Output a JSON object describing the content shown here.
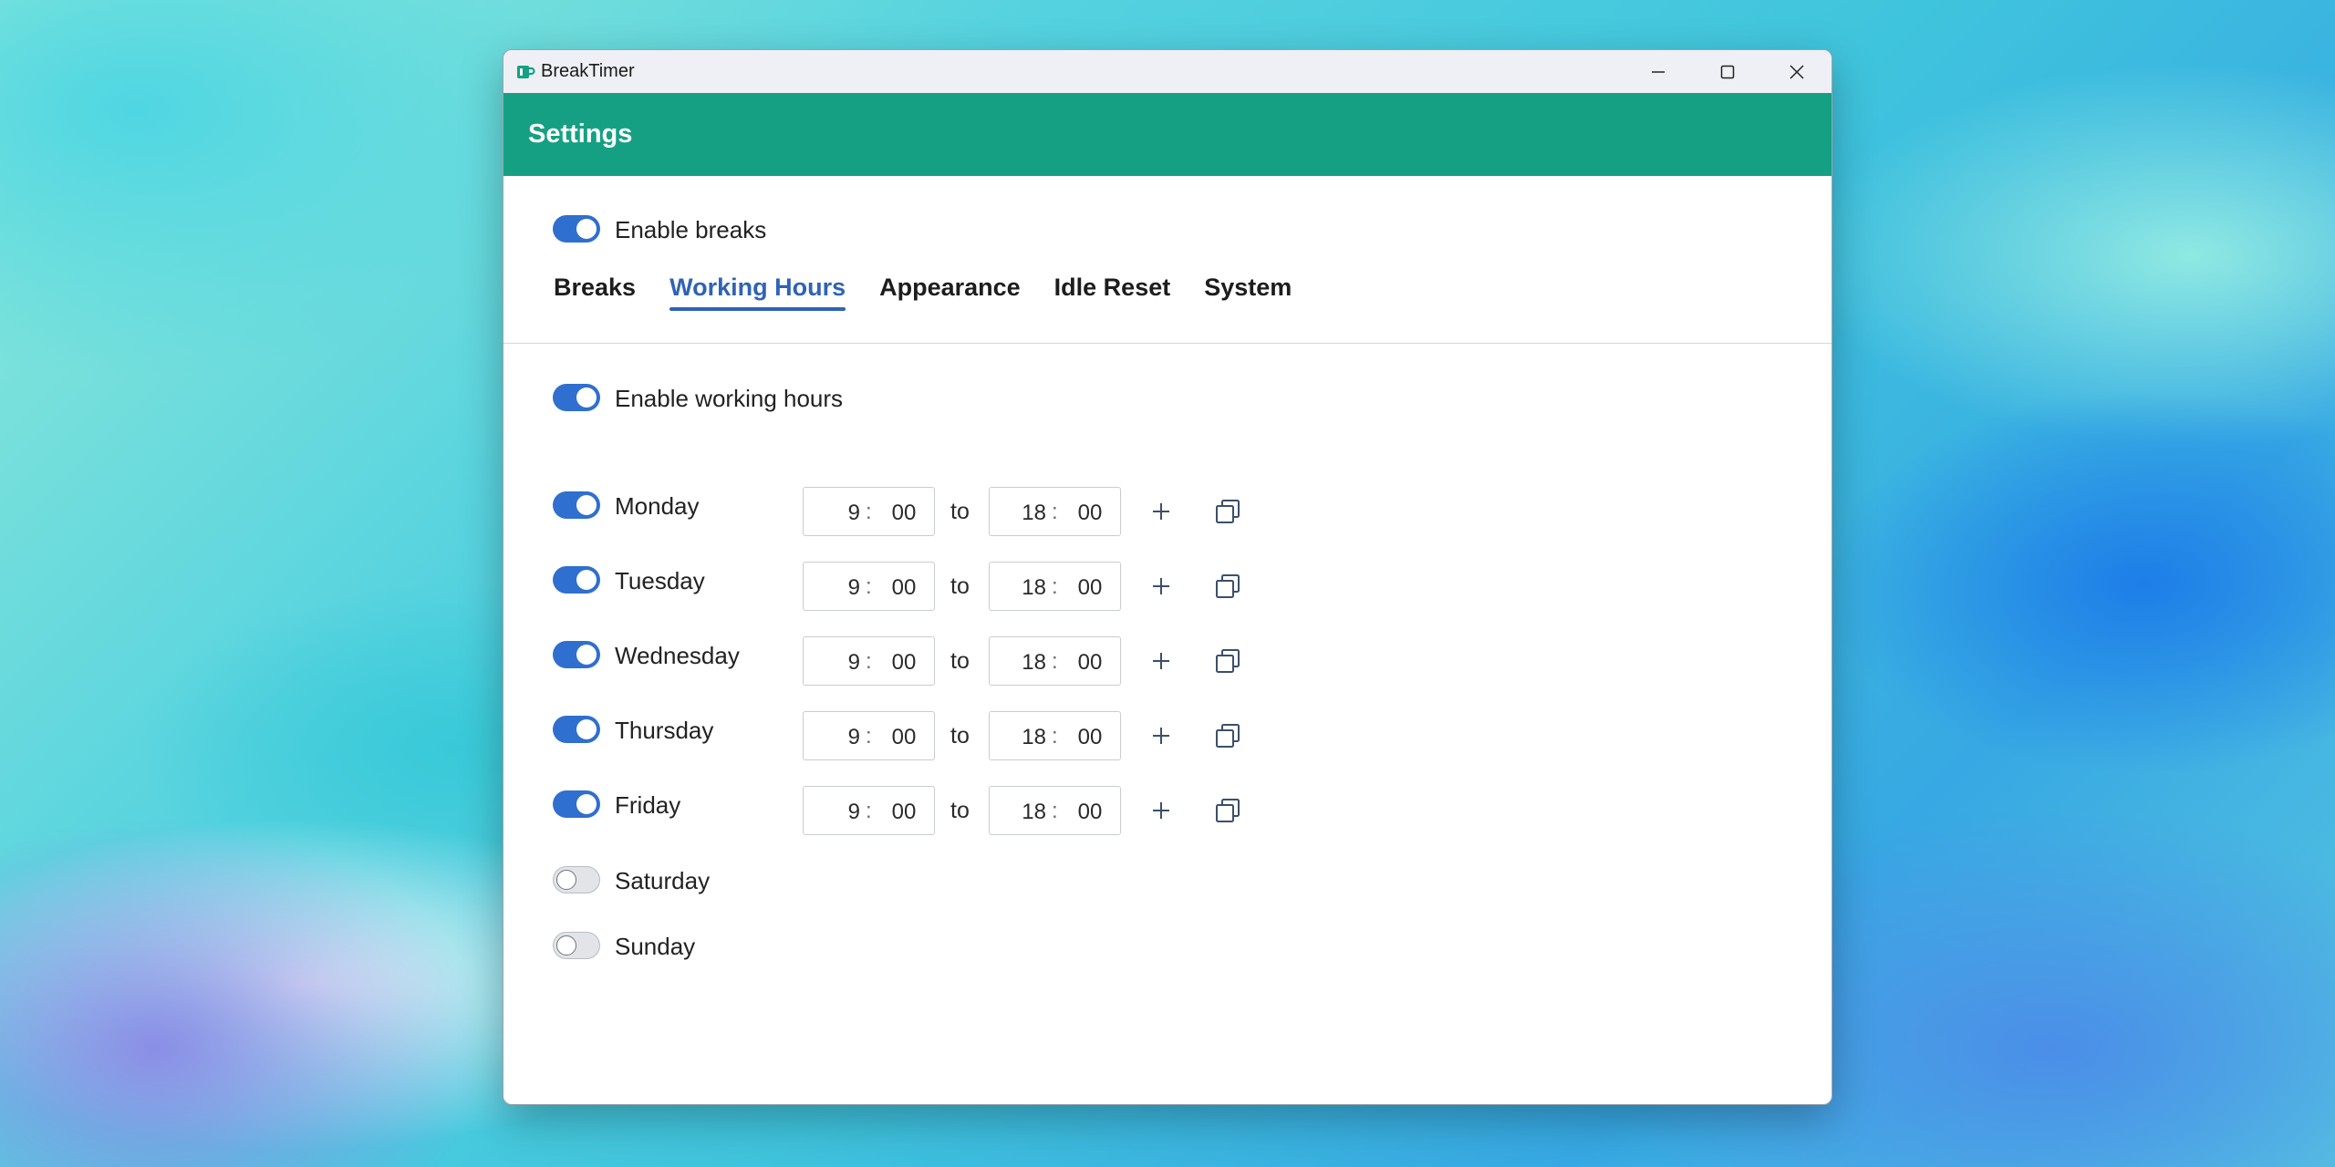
{
  "window": {
    "title": "BreakTimer",
    "icon": "coffee-cup-icon",
    "accent_color": "#16a083",
    "toggle_color": "#2f6fcf",
    "tab_active_color": "#2f63b5"
  },
  "header": {
    "title": "Settings"
  },
  "enable_breaks": {
    "label": "Enable breaks",
    "on": true
  },
  "tabs": [
    {
      "label": "Breaks",
      "active": false
    },
    {
      "label": "Working Hours",
      "active": true
    },
    {
      "label": "Appearance",
      "active": false
    },
    {
      "label": "Idle Reset",
      "active": false
    },
    {
      "label": "System",
      "active": false
    }
  ],
  "enable_working_hours": {
    "label": "Enable working hours",
    "on": true
  },
  "time_separator": ":",
  "to_label": "to",
  "days": [
    {
      "name": "Monday",
      "on": true,
      "start_h": "9",
      "start_m": "00",
      "end_h": "18",
      "end_m": "00"
    },
    {
      "name": "Tuesday",
      "on": true,
      "start_h": "9",
      "start_m": "00",
      "end_h": "18",
      "end_m": "00"
    },
    {
      "name": "Wednesday",
      "on": true,
      "start_h": "9",
      "start_m": "00",
      "end_h": "18",
      "end_m": "00"
    },
    {
      "name": "Thursday",
      "on": true,
      "start_h": "9",
      "start_m": "00",
      "end_h": "18",
      "end_m": "00"
    },
    {
      "name": "Friday",
      "on": true,
      "start_h": "9",
      "start_m": "00",
      "end_h": "18",
      "end_m": "00"
    },
    {
      "name": "Saturday",
      "on": false
    },
    {
      "name": "Sunday",
      "on": false
    }
  ],
  "row_icons": {
    "add": "plus-icon",
    "copy": "copy-icon"
  }
}
